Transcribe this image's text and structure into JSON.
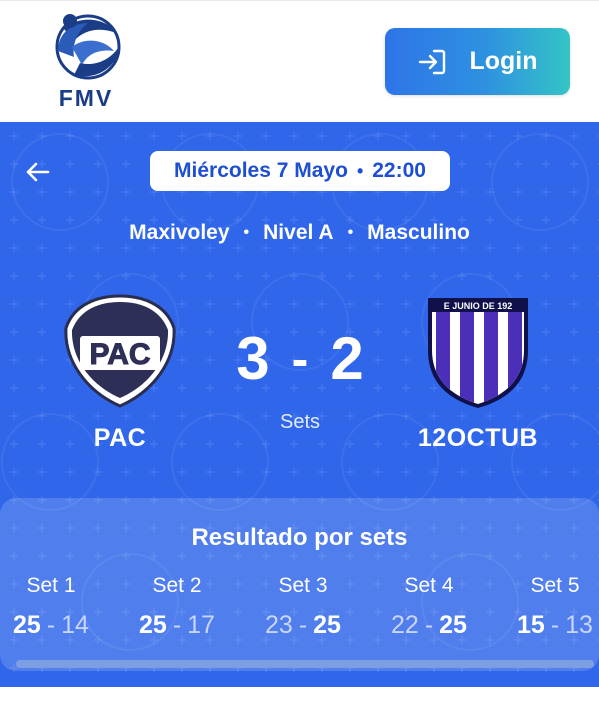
{
  "header": {
    "logo_text": "FMV",
    "login_label": "Login"
  },
  "match": {
    "date_label": "Miércoles 7 Mayo",
    "time_label": "22:00",
    "category": "Maxivoley",
    "level": "Nivel A",
    "gender": "Masculino",
    "home": {
      "name": "PAC",
      "crest_text": "PAC"
    },
    "away": {
      "name": "12OCTUB",
      "crest_text": "E JUNIO DE 192"
    },
    "home_sets": "3",
    "away_sets": "2",
    "score_separator": "-",
    "sets_caption": "Sets"
  },
  "sets_section": {
    "title": "Resultado por sets",
    "sets": [
      {
        "label": "Set 1",
        "home": "25",
        "away": "14",
        "winner": "home"
      },
      {
        "label": "Set 2",
        "home": "25",
        "away": "17",
        "winner": "home"
      },
      {
        "label": "Set 3",
        "home": "23",
        "away": "25",
        "winner": "away"
      },
      {
        "label": "Set 4",
        "home": "22",
        "away": "25",
        "winner": "away"
      },
      {
        "label": "Set 5",
        "home": "15",
        "away": "13",
        "winner": "home"
      }
    ]
  },
  "colors": {
    "card_blue": "#2f66ea",
    "login_gradient_start": "#2e74e8",
    "login_gradient_end": "#34c4c6",
    "date_text": "#1e4fd2",
    "logo_navy": "#1b3d87"
  },
  "icons": {
    "login": "login-arrow-icon",
    "back": "arrow-left-icon"
  }
}
